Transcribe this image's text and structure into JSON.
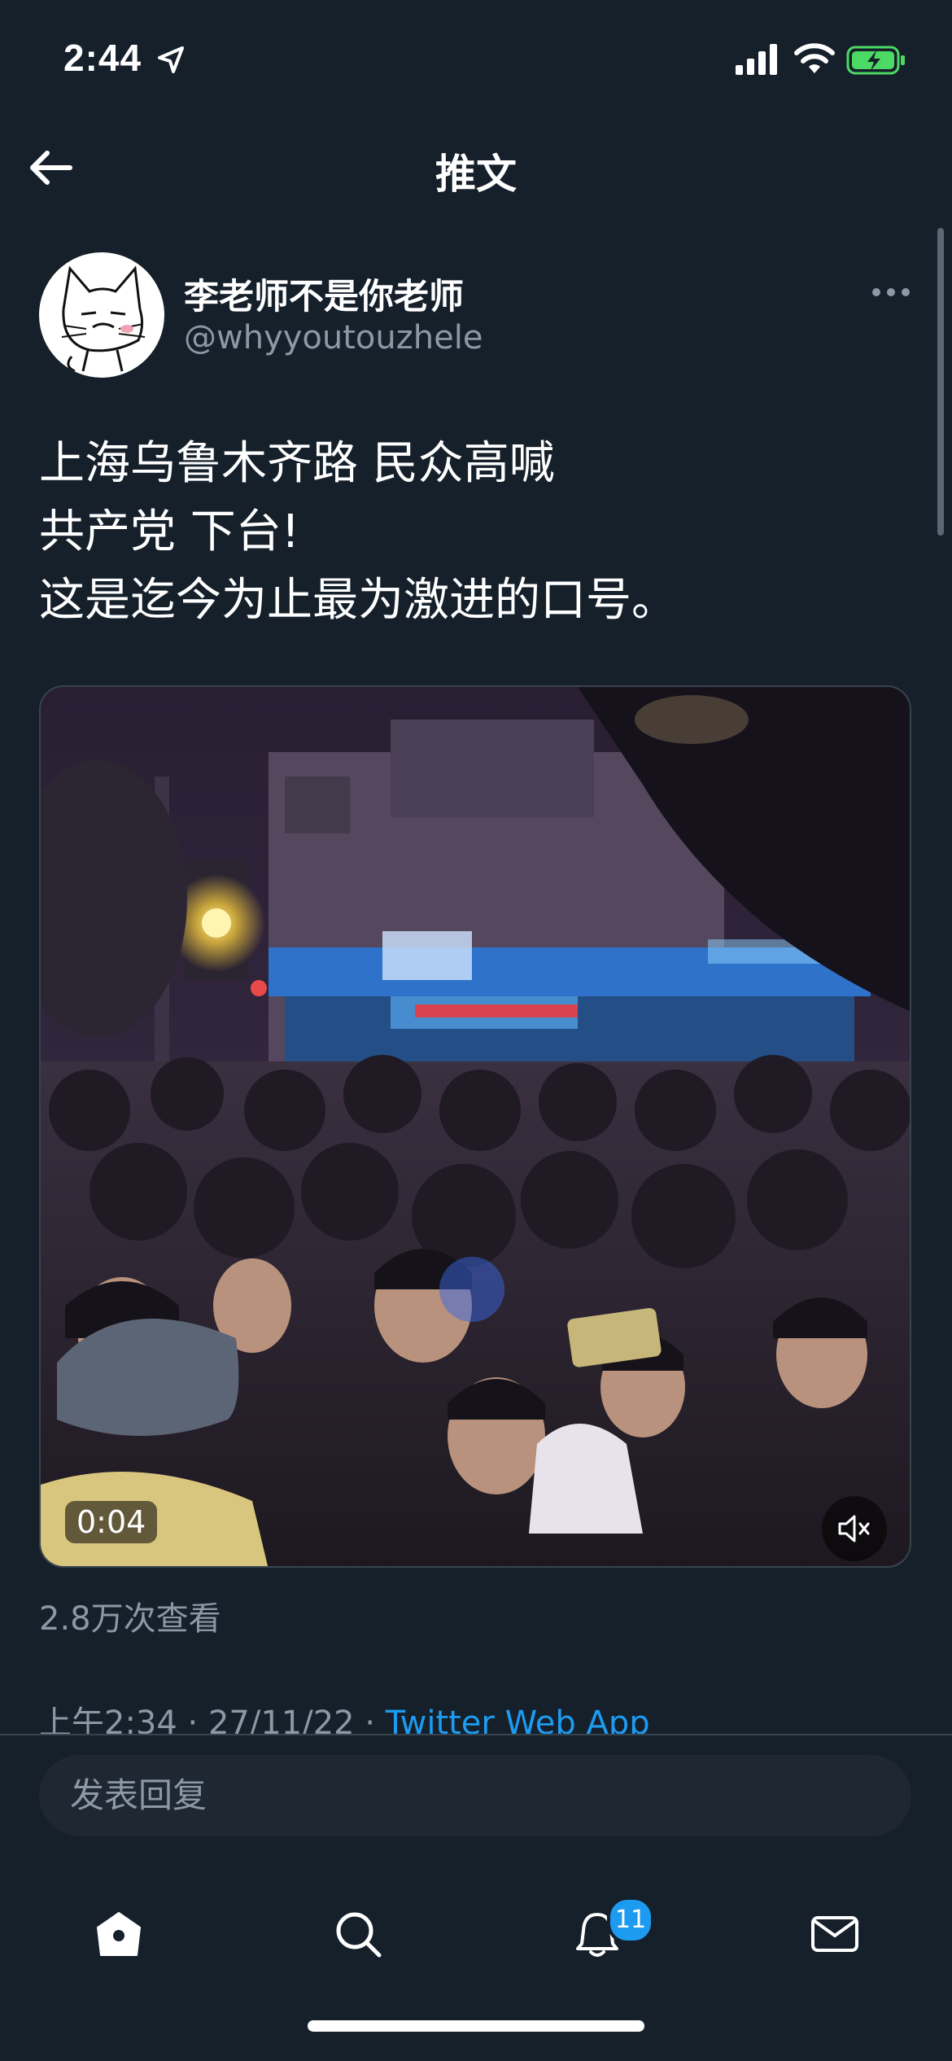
{
  "status_bar": {
    "time": "2:44"
  },
  "header": {
    "title": "推文",
    "back_icon": "arrow-left-icon"
  },
  "tweet": {
    "author_name": "李老师不是你老师",
    "author_handle": "@whyyoutouzhele",
    "text_lines": [
      "上海乌鲁木齐路 民众高喊",
      "共产党 下台!",
      "这是迄今为止最为激进的口号。"
    ],
    "video": {
      "duration": "0:04",
      "muted": true
    },
    "view_count": "2.8万次查看",
    "time": "上午2:34",
    "date": "27/11/22",
    "separator": " · ",
    "source": "Twitter Web App"
  },
  "composer": {
    "placeholder": "发表回复"
  },
  "tab_bar": {
    "items": [
      {
        "icon": "home-icon"
      },
      {
        "icon": "search-icon"
      },
      {
        "icon": "bell-icon",
        "badge": "11"
      },
      {
        "icon": "mail-icon"
      }
    ]
  },
  "colors": {
    "background": "#15202b",
    "accent": "#1d9bf0",
    "secondary_text": "#8b98a5",
    "border": "#38444d",
    "battery": "#4cd964"
  }
}
